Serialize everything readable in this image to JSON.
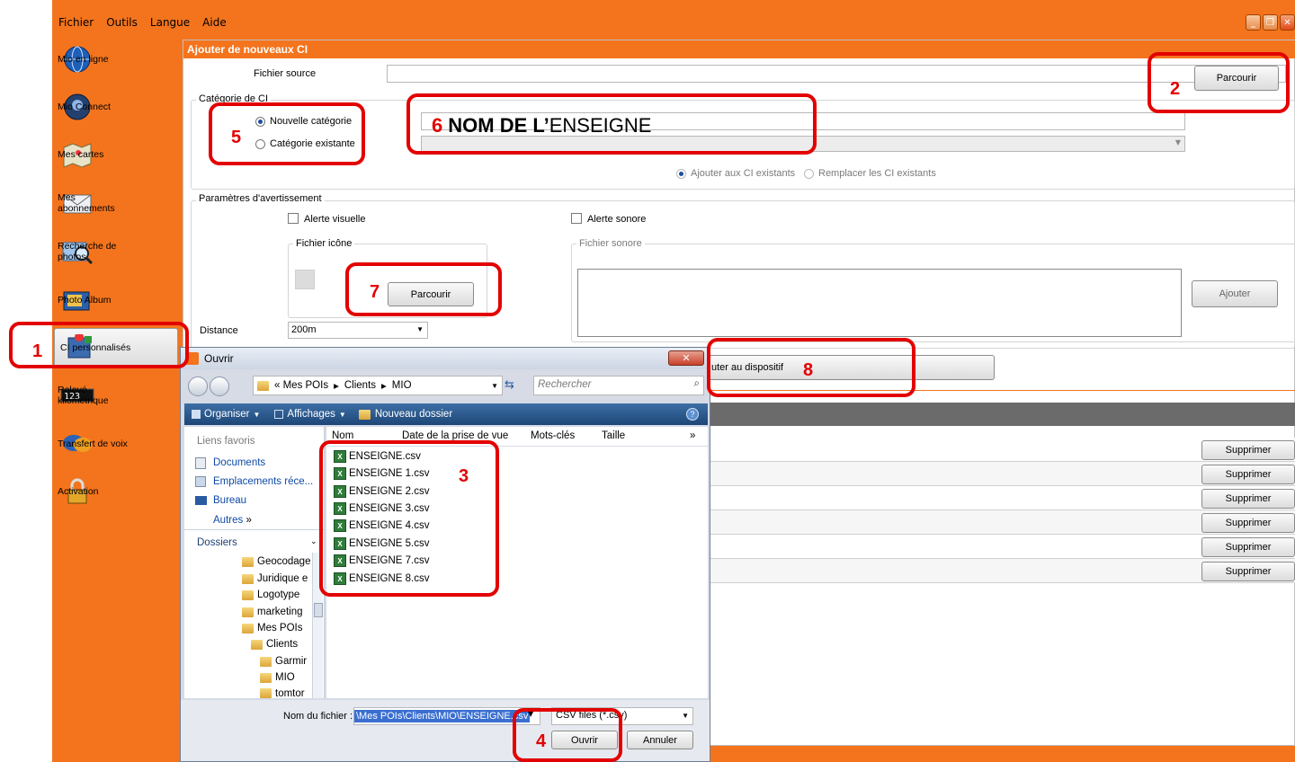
{
  "menu": [
    "Fichier",
    "Outils",
    "Langue",
    "Aide"
  ],
  "window_controls": [
    "minimize-icon",
    "restore-icon",
    "close-icon"
  ],
  "sidebar": {
    "items": [
      {
        "label": "Mio en ligne",
        "icon": "globe-icon"
      },
      {
        "label": "Mio Connect",
        "icon": "connect-icon"
      },
      {
        "label": "Mes cartes",
        "icon": "maps-icon"
      },
      {
        "label": "Mes abonnements",
        "icon": "envelope-icon"
      },
      {
        "label": "Recherche de photos",
        "icon": "photo-search-icon"
      },
      {
        "label": "Photo Album",
        "icon": "album-icon"
      },
      {
        "label": "CI personnalisés",
        "icon": "poi-icon"
      },
      {
        "label": "Relevé kilométrique",
        "icon": "odometer-icon"
      },
      {
        "label": "Transfert de voix",
        "icon": "voice-icon"
      },
      {
        "label": "Activation",
        "icon": "lock-icon"
      }
    ]
  },
  "panel": {
    "title": "Ajouter de nouveaux CI",
    "source_label": "Fichier source",
    "browse_label": "Parcourir",
    "category_group": "Catégorie de CI",
    "new_category": "Nouvelle catégorie",
    "existing_category": "Catégorie existante",
    "add_existing": "Ajouter aux CI existants",
    "replace_existing": "Remplacer les CI existants",
    "alert_group": "Paramètres d'avertissement",
    "visual_alert": "Alerte visuelle",
    "sound_alert": "Alerte sonore",
    "icon_file": "Fichier icône",
    "sound_file": "Fichier sonore",
    "icon_browse": "Parcourir",
    "add_label": "Ajouter",
    "distance_label": "Distance",
    "distance_value": "200m",
    "add_device": "uter au dispositif",
    "delete_label": "Supprimer"
  },
  "annotations": {
    "n1": "1",
    "n2": "2",
    "n3": "3",
    "n4": "4",
    "n5": "5",
    "n6": "6",
    "n7": "7",
    "n8": "8",
    "store_bold": "NOM DE L’",
    "store_rest": "ENSEIGNE"
  },
  "dialog": {
    "title": "Ouvrir",
    "path": [
      "« Mes POIs",
      "Clients",
      "MIO"
    ],
    "search_placeholder": "Rechercher",
    "toolbar": [
      "Organiser",
      "Affichages",
      "Nouveau dossier"
    ],
    "favorites_header": "Liens favoris",
    "favorites": [
      "Documents",
      "Emplacements réce...",
      "Bureau"
    ],
    "others": "Autres",
    "folders_header": "Dossiers",
    "tree": [
      "Geocodage",
      "Juridique e",
      "Logotype",
      "marketing",
      "Mes POIs",
      "Clients",
      "Garmir",
      "MIO",
      "tomtor"
    ],
    "columns": [
      "Nom",
      "Date de la prise de vue",
      "Mots-clés",
      "Taille"
    ],
    "files": [
      "ENSEIGNE.csv",
      "ENSEIGNE 1.csv",
      "ENSEIGNE 2.csv",
      "ENSEIGNE 3.csv",
      "ENSEIGNE 4.csv",
      "ENSEIGNE 5.csv",
      "ENSEIGNE 7.csv",
      "ENSEIGNE 8.csv"
    ],
    "filename_label": "Nom du fichier :",
    "filename_value": "\\Mes POIs\\Clients\\MIO\\ENSEIGNE.csv",
    "filetype_value": "CSV files (*.csv)",
    "open_label": "Ouvrir",
    "cancel_label": "Annuler"
  },
  "colors": {
    "orange": "#f4741d",
    "annotation": "#e30000",
    "link": "#0f4aa8"
  }
}
